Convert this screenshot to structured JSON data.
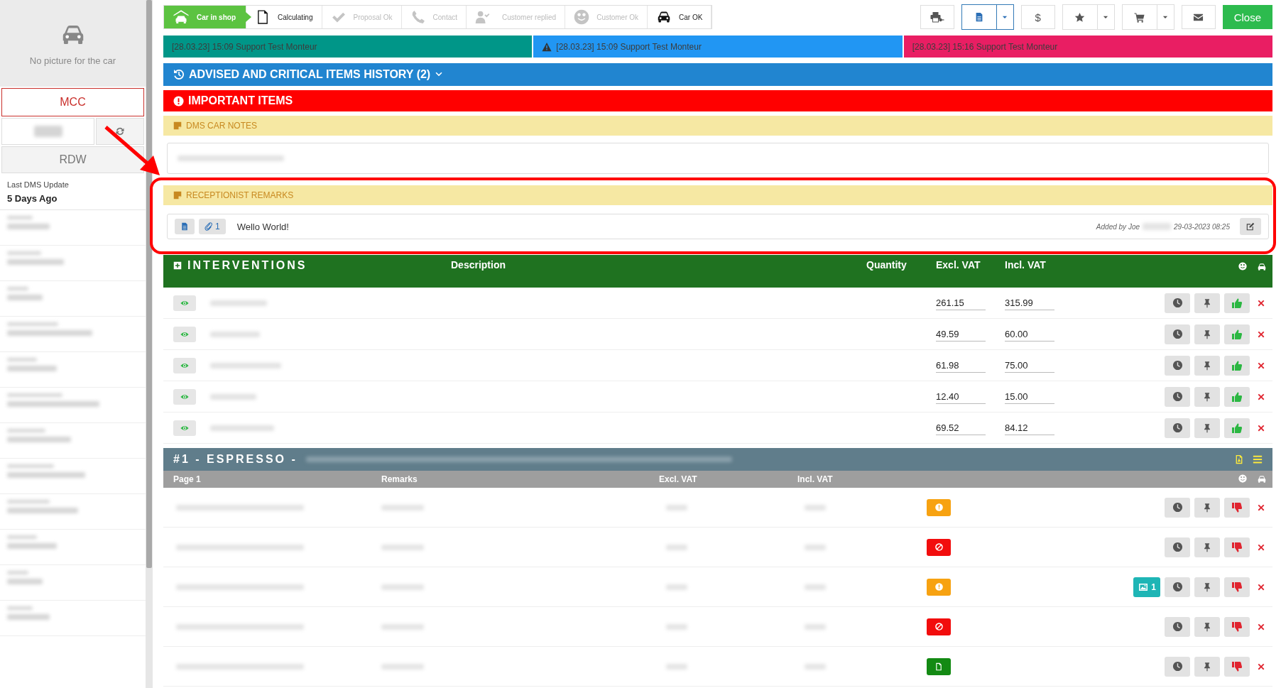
{
  "sidebar": {
    "no_picture_text": "No picture for the car",
    "mcc_button": "MCC",
    "rdw_button": "RDW",
    "last_update_label": "Last DMS Update",
    "last_update_value": "5 Days Ago"
  },
  "progress_steps": [
    {
      "label": "Car in shop",
      "kind": "garage",
      "selected": true,
      "done": true
    },
    {
      "label": "Calculating",
      "kind": "document",
      "selected": false,
      "done": true
    },
    {
      "label": "Proposal Ok",
      "kind": "check",
      "selected": false,
      "done": false
    },
    {
      "label": "Contact",
      "kind": "phone",
      "selected": false,
      "done": false
    },
    {
      "label": "Customer replied",
      "kind": "user-check",
      "selected": false,
      "done": false
    },
    {
      "label": "Customer Ok",
      "kind": "smiley",
      "selected": false,
      "done": false
    },
    {
      "label": "Car OK",
      "kind": "car",
      "selected": false,
      "done": true
    }
  ],
  "toolbar": {
    "dollar_button": "$",
    "close_button": "Close"
  },
  "messages": [
    {
      "text": "[28.03.23] 15:09 Support Test Monteur",
      "color": "#009688",
      "warning": false
    },
    {
      "text": "[28.03.23] 15:09 Support Test Monteur",
      "color": "#2196f3",
      "warning": true
    },
    {
      "text": "[28.03.23] 15:16 Support Test Monteur",
      "color": "#e91e63",
      "warning": false
    }
  ],
  "history_bar": {
    "title": "ADVISED AND CRITICAL ITEMS HISTORY (2)"
  },
  "important_bar": {
    "title": "IMPORTANT ITEMS"
  },
  "dms_notes": {
    "title": "DMS CAR NOTES"
  },
  "receptionist_remarks": {
    "title": "RECEPTIONIST REMARKS",
    "attachment_count": "1",
    "text": "Wello World!",
    "added_by": "Added by Joe",
    "timestamp": "29-03-2023 08:25"
  },
  "interventions": {
    "title": "INTERVENTIONS",
    "columns": [
      "Description",
      "Quantity",
      "Excl. VAT",
      "Incl. VAT"
    ],
    "rows": [
      {
        "excl_vat": "261.15",
        "incl_vat": "315.99",
        "approved": true
      },
      {
        "excl_vat": "49.59",
        "incl_vat": "60.00",
        "approved": true
      },
      {
        "excl_vat": "61.98",
        "incl_vat": "75.00",
        "approved": true
      },
      {
        "excl_vat": "12.40",
        "incl_vat": "15.00",
        "approved": true
      },
      {
        "excl_vat": "69.52",
        "incl_vat": "84.12",
        "approved": true
      }
    ]
  },
  "quote": {
    "title": "#1 - ESPRESSO -",
    "columns": [
      "Page 1",
      "Remarks",
      "Excl. VAT",
      "Incl. VAT"
    ],
    "rows": [
      {
        "kind": "warning",
        "approved": false
      },
      {
        "kind": "blocked",
        "approved": false
      },
      {
        "kind": "warning",
        "photo_count": "1",
        "approved": false
      },
      {
        "kind": "blocked",
        "approved": false
      },
      {
        "kind": "document",
        "approved": false
      }
    ]
  }
}
